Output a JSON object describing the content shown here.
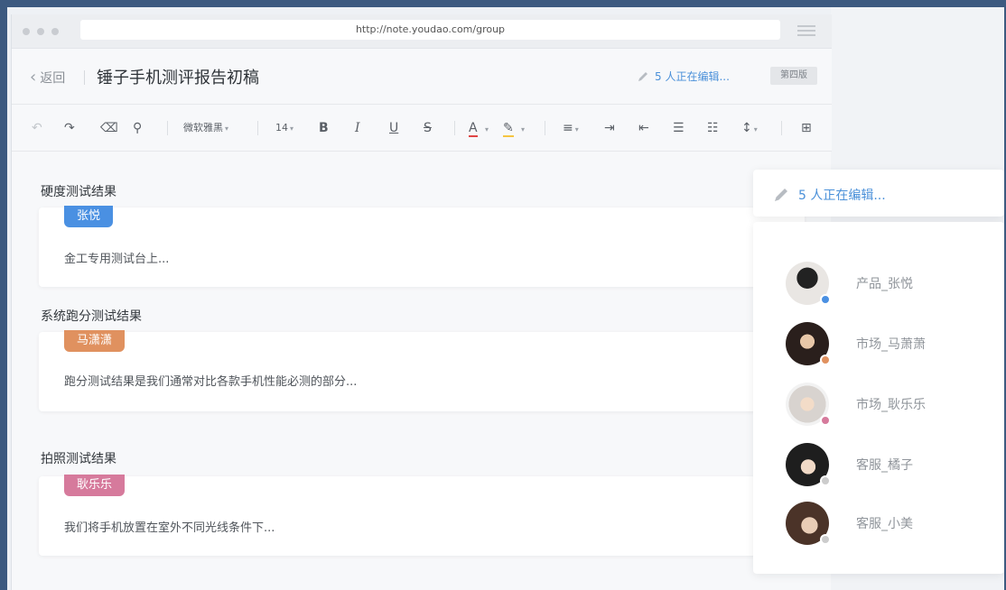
{
  "browser": {
    "url": "http://note.youdao.com/group"
  },
  "header": {
    "back_label": "返回",
    "doc_title": "锤子手机测评报告初稿",
    "editing_text": "5 人正在编辑...",
    "version_badge": "第四版"
  },
  "toolbar": {
    "font_family": "微软雅黑",
    "font_size": "14",
    "bold": "B",
    "italic": "I",
    "underline": "U",
    "strike": "S",
    "font_color": "A"
  },
  "sections": [
    {
      "label": "硬度测试结果",
      "tag": "张悦",
      "tag_color": "#4a90e2",
      "text": "金工专用测试台上..."
    },
    {
      "label": "系统跑分测试结果",
      "tag": "马潇潇",
      "tag_color": "#e0915f",
      "text": "跑分测试结果是我们通常对比各款手机性能必测的部分..."
    },
    {
      "label": "拍照测试结果",
      "tag": "耿乐乐",
      "tag_color": "#d67a9c",
      "text": "我们将手机放置在室外不同光线条件下..."
    }
  ],
  "editors_panel": {
    "title": "5 人正在编辑...",
    "users": [
      {
        "name": "产品_张悦",
        "status_color": "#4a90e2"
      },
      {
        "name": "市场_马萧萧",
        "status_color": "#e0915f"
      },
      {
        "name": "市场_耿乐乐",
        "status_color": "#d67a9c"
      },
      {
        "name": "客服_橘子",
        "status_color": "#cccccc"
      },
      {
        "name": "客服_小美",
        "status_color": "#cccccc"
      }
    ]
  },
  "colors": {
    "accent": "#4a90d9",
    "frame": "#3d5a80"
  }
}
